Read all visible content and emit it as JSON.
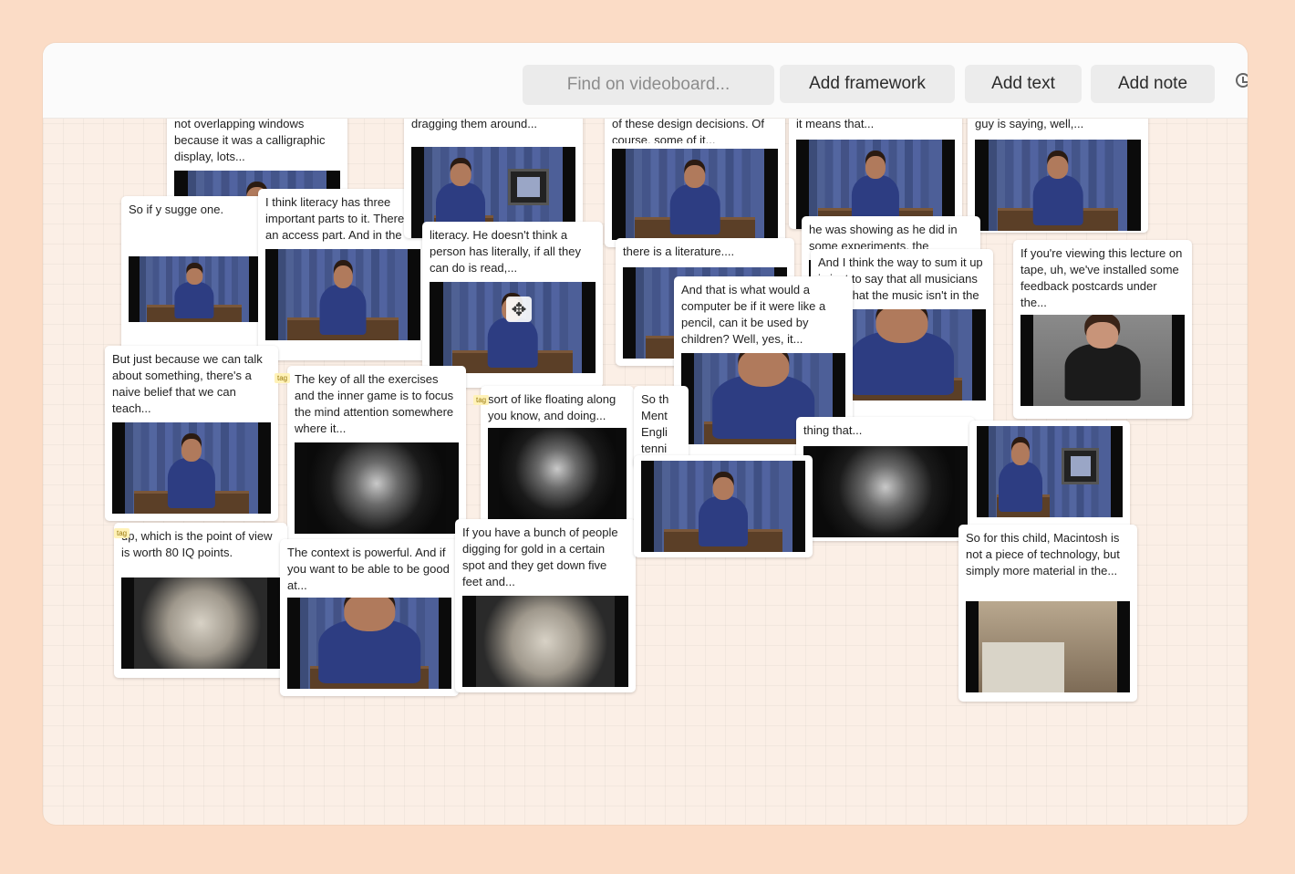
{
  "toolbar": {
    "search_placeholder": "Find on videoboard...",
    "add_framework": "Add framework",
    "add_text": "Add text",
    "add_note": "Add note"
  },
  "cards": [
    {
      "caption": "not overlapping windows because it was a calligraphic display, lots...",
      "variant": "lecture"
    },
    {
      "caption": "So if y sugge one.",
      "variant": "lecture"
    },
    {
      "caption": "I think literacy has three important parts to it. There's an access part. And in the print...",
      "variant": "lecture"
    },
    {
      "caption": "dragging them around...",
      "variant": "tv"
    },
    {
      "caption": "literacy. He doesn't think a person has literally, if all they can do is read,...",
      "variant": "lecture"
    },
    {
      "caption": "of these design decisions. Of course, some of it...",
      "variant": "lecture"
    },
    {
      "caption": "it means that...",
      "variant": "lecture"
    },
    {
      "caption": "guy is saying, well,...",
      "variant": "lecture"
    },
    {
      "caption": "there is a literature....",
      "variant": "lecture"
    },
    {
      "caption": "he was showing as he did in some experiments, the",
      "variant": "lecture"
    },
    {
      "caption": "And I think the way to sum it up is just to say that all musicians know that the music isn't in the piano, if...",
      "variant": "closeup"
    },
    {
      "caption": "If you're viewing this lecture on tape, uh, we've installed some feedback postcards under the...",
      "variant": "woman"
    },
    {
      "caption": "And that is what would a computer be if it were like a pencil, can it be used by children? Well, yes, it...",
      "variant": "closeup"
    },
    {
      "caption": "But just because we can talk about something, there's a naive belief that we can teach...",
      "variant": "lecture"
    },
    {
      "caption": "The key of all the exercises and the inner game is to focus the mind attention somewhere where it...",
      "variant": "dark"
    },
    {
      "caption": "sort of like floating along you know, and doing...",
      "variant": "dark"
    },
    {
      "caption": "So th Ment Engli tenni",
      "variant": "lecture"
    },
    {
      "caption": "thing that...",
      "variant": "dark"
    },
    {
      "caption": "up, which is the point of view is worth 80 IQ points.",
      "variant": "sketch"
    },
    {
      "caption": "The context is powerful. And if you want to be able to be good at...",
      "variant": "closeup"
    },
    {
      "caption": "If you have a bunch of people digging for gold in a certain spot and they get down five feet and...",
      "variant": "sketch"
    },
    {
      "caption": "",
      "variant": "tv"
    },
    {
      "caption": "",
      "variant": "lecture"
    },
    {
      "caption": "So for this child, Macintosh is not a piece of technology, but simply more material in the...",
      "variant": "mac"
    }
  ],
  "icons": {
    "move": "move-icon",
    "clock": "clock-icon"
  }
}
